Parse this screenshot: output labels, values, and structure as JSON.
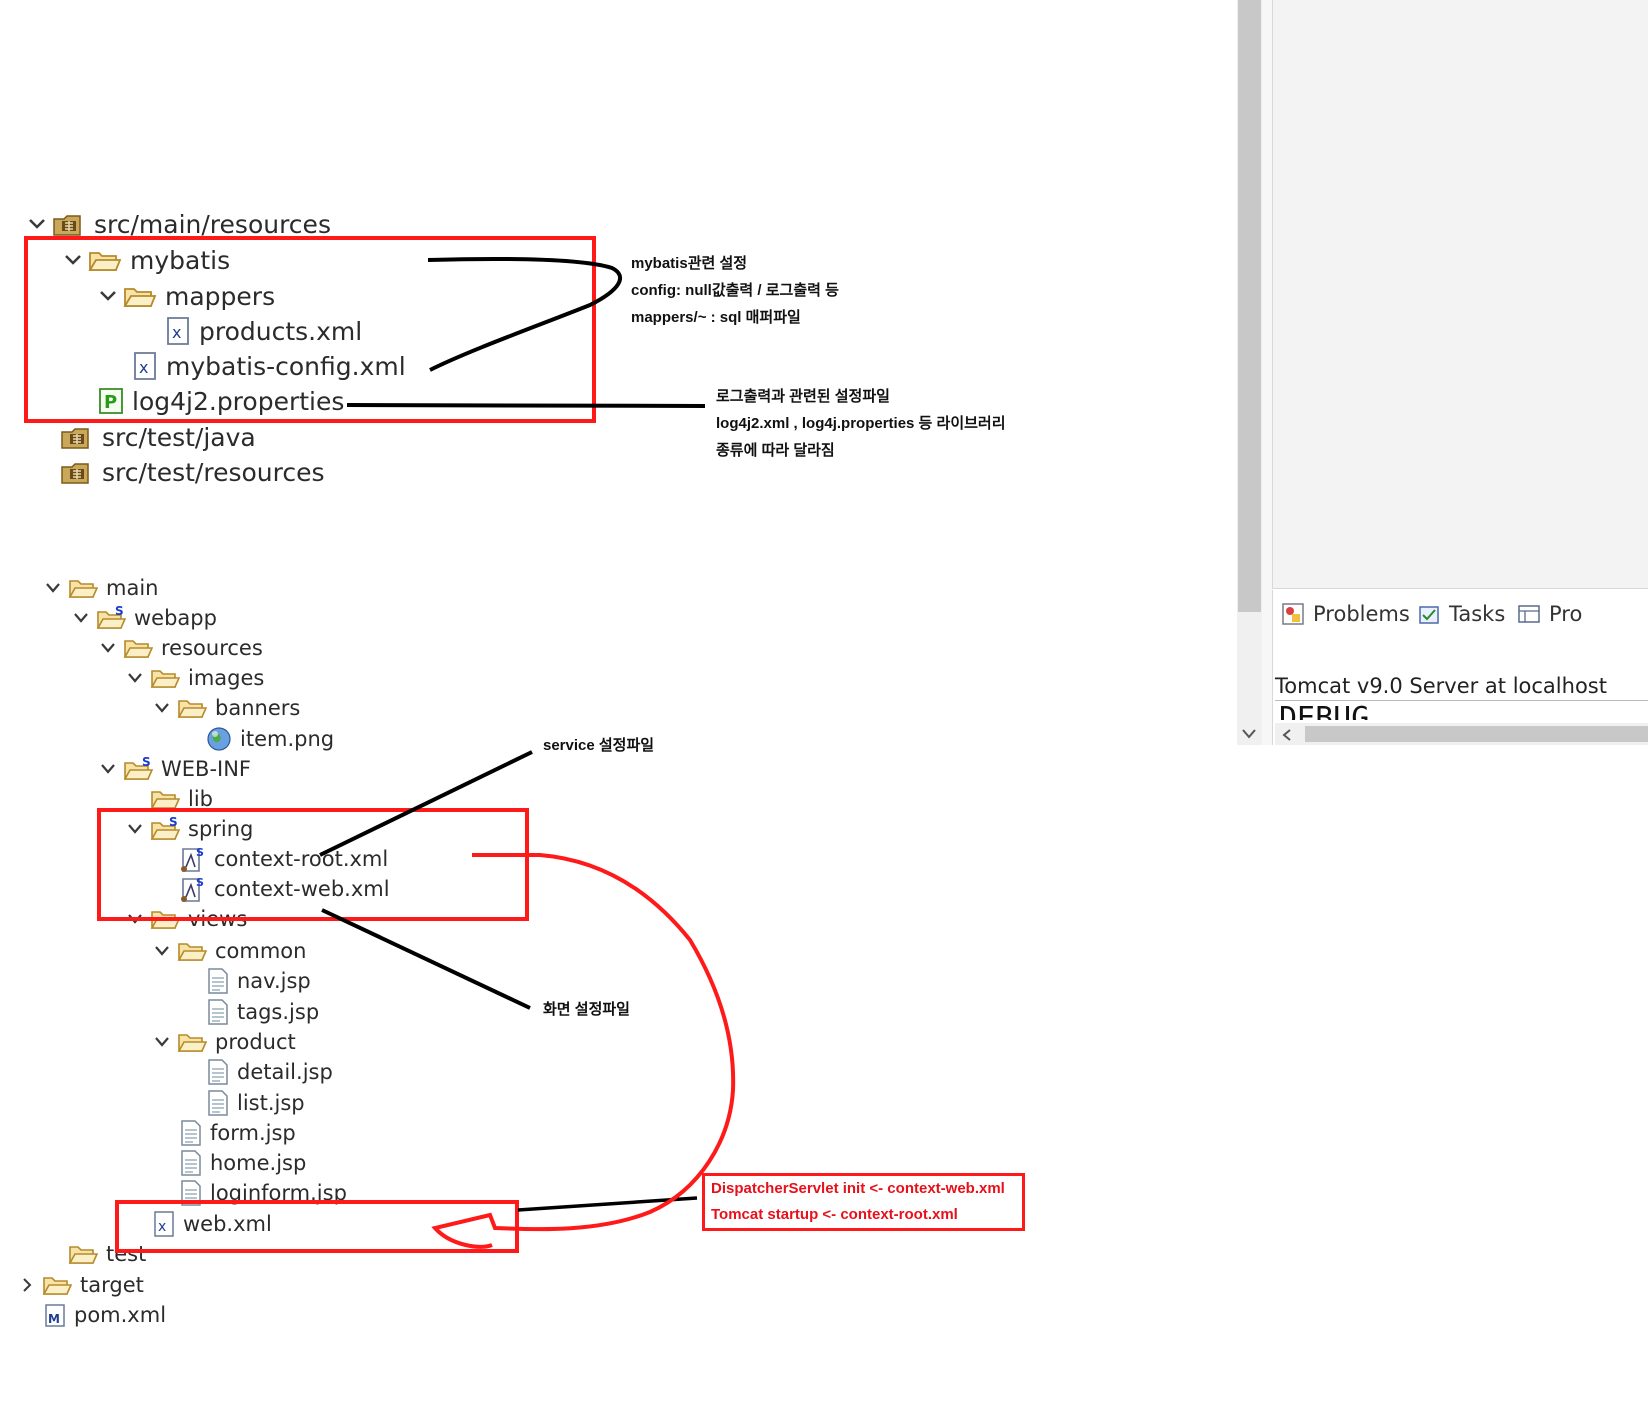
{
  "tree1": {
    "items": [
      {
        "label": "src/main/resources",
        "icon": "package-folder-icon",
        "expanded": true
      },
      {
        "label": "mybatis",
        "icon": "folder-icon",
        "expanded": true
      },
      {
        "label": "mappers",
        "icon": "folder-icon",
        "expanded": true
      },
      {
        "label": "products.xml",
        "icon": "xml-file-icon"
      },
      {
        "label": "mybatis-config.xml",
        "icon": "xml-file-icon"
      },
      {
        "label": "log4j2.properties",
        "icon": "properties-file-icon"
      },
      {
        "label": "src/test/java",
        "icon": "package-folder-icon"
      },
      {
        "label": "src/test/resources",
        "icon": "package-folder-icon"
      }
    ]
  },
  "tree2": {
    "items": [
      {
        "label": "main",
        "icon": "folder-icon",
        "expanded": true
      },
      {
        "label": "webapp",
        "icon": "spring-folder-icon",
        "expanded": true
      },
      {
        "label": "resources",
        "icon": "folder-icon",
        "expanded": true
      },
      {
        "label": "images",
        "icon": "folder-icon",
        "expanded": true
      },
      {
        "label": "banners",
        "icon": "folder-icon",
        "expanded": true
      },
      {
        "label": "item.png",
        "icon": "globe-icon"
      },
      {
        "label": "WEB-INF",
        "icon": "spring-folder-icon",
        "expanded": true
      },
      {
        "label": "lib",
        "icon": "folder-icon"
      },
      {
        "label": "spring",
        "icon": "spring-folder-icon",
        "expanded": true
      },
      {
        "label": "context-root.xml",
        "icon": "spring-bean-file-icon"
      },
      {
        "label": "context-web.xml",
        "icon": "spring-bean-file-icon"
      },
      {
        "label": "views",
        "icon": "folder-icon",
        "expanded": true
      },
      {
        "label": "common",
        "icon": "folder-icon",
        "expanded": true
      },
      {
        "label": "nav.jsp",
        "icon": "jsp-file-icon"
      },
      {
        "label": "tags.jsp",
        "icon": "jsp-file-icon"
      },
      {
        "label": "product",
        "icon": "folder-icon",
        "expanded": true
      },
      {
        "label": "detail.jsp",
        "icon": "jsp-file-icon"
      },
      {
        "label": "list.jsp",
        "icon": "jsp-file-icon"
      },
      {
        "label": "form.jsp",
        "icon": "jsp-file-icon"
      },
      {
        "label": "home.jsp",
        "icon": "jsp-file-icon"
      },
      {
        "label": "loginform.jsp",
        "icon": "jsp-file-icon"
      },
      {
        "label": "web.xml",
        "icon": "xml-file-icon"
      },
      {
        "label": "test",
        "icon": "folder-icon"
      },
      {
        "label": "target",
        "icon": "folder-icon",
        "expanded": false
      },
      {
        "label": "pom.xml",
        "icon": "maven-file-icon"
      }
    ]
  },
  "notes": {
    "mybatis": [
      "mybatis관련 설정",
      "config: null값출력 / 로그출력 등",
      "mappers/~ : sql 매퍼파일"
    ],
    "log": [
      "로그출력과 관련된 설정파일",
      "log4j2.xml , log4j.properties 등 라이브러리",
      "종류에 따라 달라짐"
    ],
    "service": "service 설정파일",
    "view": "화면 설정파일",
    "dispatcher": [
      "DispatcherServlet init <- context-web.xml",
      "Tomcat startup <- context-root.xml"
    ]
  },
  "right_panel": {
    "tabs": [
      {
        "label": "Problems",
        "icon": "problems-icon"
      },
      {
        "label": "Tasks",
        "icon": "tasks-icon"
      },
      {
        "label": "Pro",
        "icon": "properties-view-icon"
      }
    ],
    "console_title": "Tomcat v9.0 Server at localhost",
    "console_line": "DEBUG"
  },
  "colors": {
    "annotation_red": "#ff1a1a",
    "annotation_black": "#000000",
    "scrollbar": "#c8c8c8"
  }
}
